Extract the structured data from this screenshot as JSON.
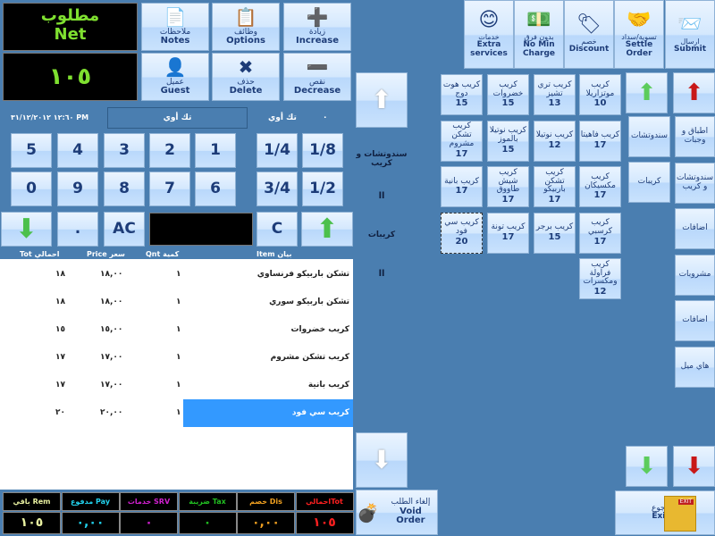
{
  "net": {
    "label_ar": "مطلوب",
    "label_en": "Net",
    "value": "١٠٥"
  },
  "actions": [
    {
      "ar": "ملاحظات",
      "en": "Notes",
      "icon": "notes-icon",
      "glyph": "📄"
    },
    {
      "ar": "وظائف",
      "en": "Options",
      "icon": "clipboard-icon",
      "glyph": "📋"
    },
    {
      "ar": "زيادة",
      "en": "Increase",
      "icon": "plus-icon",
      "glyph": "➕"
    },
    {
      "ar": "عميل",
      "en": "Guest",
      "icon": "guest-icon",
      "glyph": "👤"
    },
    {
      "ar": "حذف",
      "en": "Delete",
      "icon": "delete-x-icon",
      "glyph": "✖"
    },
    {
      "ar": "نقص",
      "en": "Decrease",
      "icon": "minus-icon",
      "glyph": "➖"
    }
  ],
  "info": {
    "datetime": "PM ١٢:٦٠ ٣١/١٢/٢٠١٢",
    "box": "تك أوي",
    "type": "تك أوي",
    "dot": "٠"
  },
  "keypad": {
    "row1": [
      "5",
      "4",
      "3",
      "2",
      "1"
    ],
    "row2": [
      "0",
      "9",
      "8",
      "7",
      "6"
    ],
    "fractions": [
      "1/4",
      "1/8",
      "3/4",
      "1/2"
    ],
    "dot": ".",
    "ac": "AC",
    "c": "C"
  },
  "table": {
    "headers": {
      "tot": "احمالي Tot",
      "price": "سعر Price",
      "qnt": "كمية Qnt",
      "item": "بيان Item"
    },
    "rows": [
      {
        "item": "تشكن باربيكو  فرنساوي",
        "qnt": "١",
        "price": "١٨,٠٠",
        "tot": "١٨"
      },
      {
        "item": "تشكن باربيكو  سوري",
        "qnt": "١",
        "price": "١٨,٠٠",
        "tot": "١٨"
      },
      {
        "item": "كريب خضروات",
        "qnt": "١",
        "price": "١٥,٠٠",
        "tot": "١٥"
      },
      {
        "item": "كريب تشكن مشروم",
        "qnt": "١",
        "price": "١٧,٠٠",
        "tot": "١٧"
      },
      {
        "item": "كريب بانية",
        "qnt": "١",
        "price": "١٧,٠٠",
        "tot": "١٧"
      },
      {
        "item": "كريب سي فود",
        "qnt": "١",
        "price": "٢٠,٠٠",
        "tot": "٢٠",
        "selected": true
      }
    ]
  },
  "totals": [
    {
      "label": "باقي Rem",
      "value": "١٠٥",
      "color": "#e8f0a0"
    },
    {
      "label": "مدفوع Pay",
      "value": "٠,٠٠",
      "color": "#22d3ee"
    },
    {
      "label": "خدمات SRV",
      "value": "٠",
      "color": "#d020d0"
    },
    {
      "label": "ضريبة Tax",
      "value": "٠",
      "color": "#22c022"
    },
    {
      "label": "خصم Dis",
      "value": "٠,٠٠",
      "color": "#f0a020"
    },
    {
      "label": "احماليTot",
      "value": "١٠٥",
      "color": "#ff2020"
    }
  ],
  "middle": {
    "path1": "سندوتشات و كريب",
    "sep1": "ll",
    "path2": "كريبات",
    "sep2": "ll",
    "void_ar": "إلغاء الطلب",
    "void_en": "Void Order"
  },
  "top_buttons": [
    {
      "ar": "خدمات",
      "en": "Extra services",
      "icon": "smiley-icon",
      "glyph": "😊"
    },
    {
      "ar": "بدون فرق",
      "en": "No Min Charge",
      "icon": "money-icon",
      "glyph": "💵"
    },
    {
      "ar": "خصم",
      "en": "Discount",
      "icon": "tag-icon",
      "glyph": "🏷"
    },
    {
      "ar": "تسوية/سداد",
      "en": "Settle Order",
      "icon": "handshake-icon",
      "glyph": "🤝"
    },
    {
      "ar": "ارسال",
      "en": "Submit",
      "icon": "submit-icon",
      "glyph": "📨"
    }
  ],
  "menu_items": [
    {
      "name": "كريب موتزاريلا",
      "price": "10"
    },
    {
      "name": "كريب تري تشيز",
      "price": "13"
    },
    {
      "name": "كريب خضروات",
      "price": "15"
    },
    {
      "name": "كريب هوت دوج",
      "price": "15"
    },
    {
      "name": "كريب فاهيتا",
      "price": "17"
    },
    {
      "name": "كريب نوتيلا",
      "price": "12"
    },
    {
      "name": "كريب نوتيلا بالموز",
      "price": "15"
    },
    {
      "name": "كريب تشكن مشروم",
      "price": "17"
    },
    {
      "name": "كريب مكسيكان",
      "price": "17"
    },
    {
      "name": "كريب تشكن باربيكو",
      "price": "17"
    },
    {
      "name": "كريب شيش طاووق",
      "price": "17"
    },
    {
      "name": "كريب بانية",
      "price": "17"
    },
    {
      "name": "كريب كرسبي",
      "price": "17"
    },
    {
      "name": "كريب برجر",
      "price": "15"
    },
    {
      "name": "كريب تونة",
      "price": "17"
    },
    {
      "name": "كريب سي فود",
      "price": "20",
      "focused": true
    },
    {
      "name": "كريب فراولة ومكسرات",
      "price": "12"
    }
  ],
  "subcategories": [
    "سندوتشات",
    "كريبات"
  ],
  "categories": [
    "اطباق و وجبات",
    "سندوتشات و كريب",
    "اضافات",
    "مشروبات",
    "اضافات",
    "هاي ميل"
  ],
  "exit": {
    "ar": "رجوع",
    "en": "Exit"
  }
}
